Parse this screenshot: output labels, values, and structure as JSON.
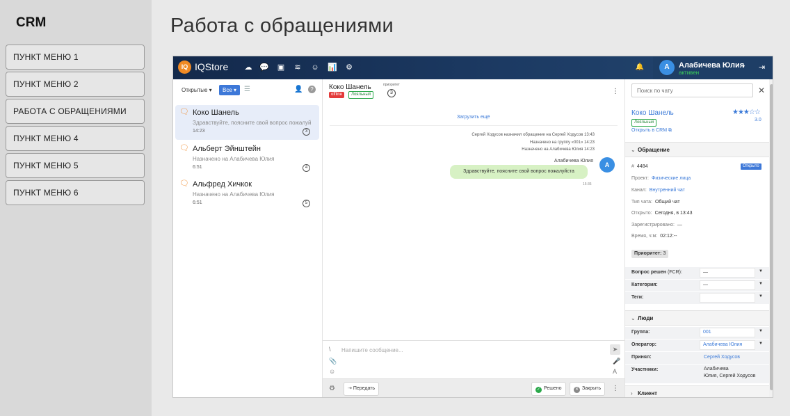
{
  "sidebar": {
    "title": "CRM",
    "items": [
      "ПУНКТ МЕНЮ 1",
      "ПУНКТ МЕНЮ 2",
      "РАБОТА С ОБРАЩЕНИЯМИ",
      "ПУНКТ МЕНЮ 4",
      "ПУНКТ МЕНЮ 5",
      "ПУНКТ МЕНЮ 6"
    ]
  },
  "page": {
    "title": "Работа с обращениями"
  },
  "app": {
    "logo": {
      "mark": "IQ",
      "name": "IQStore"
    },
    "topbar": {
      "icons": [
        "chats-icon",
        "messages-icon",
        "book-icon",
        "layers-icon",
        "users-icon",
        "stats-icon",
        "settings-icon"
      ],
      "user": {
        "avatar": "А",
        "name": "Алабичева Юлия",
        "status": "активен"
      }
    },
    "list": {
      "filter_open": "Открытые ▾",
      "filter_all": "Все ▾",
      "chats": [
        {
          "name": "Коко Шанель",
          "message": "Здравствуйте, поясните свой вопрос пожалуй",
          "time": "14:23",
          "count": "3"
        },
        {
          "name": "Альберт Эйнштейн",
          "message": "Назначено на Алабичева Юлия",
          "time": "6:51",
          "count": "4"
        },
        {
          "name": "Альфред Хичкок",
          "message": "Назначено на Алабичева Юлия",
          "time": "6:51",
          "count": "5"
        }
      ]
    },
    "chat": {
      "name": "Коко Шанель",
      "offline": "offline",
      "loyal": "Лояльный",
      "priority_label": "приоритет",
      "priority": "3",
      "load_more": "Загрузить ещё",
      "system": [
        "Сергей Ходусов назначил обращение на Сергей Ходусов 13:43",
        "Назначено на группу «001» 14:23",
        "Назначено на Алабичева Юлия 14:23"
      ],
      "message": {
        "author": "Алабичева Юлия",
        "avatar": "А",
        "text": "Здравствуйте, поясните свой вопрос пожалуйста",
        "time": "15:36"
      },
      "composer_placeholder": "Напишите сообщение...",
      "actions": {
        "transfer": "Передать",
        "resolved": "Решено",
        "close": "Закрыть"
      }
    },
    "details": {
      "search_placeholder": "Поиск по чату",
      "client_name": "Коко Шанель",
      "stars": "★★★☆☆",
      "rating": "3.0",
      "loyal": "Лояльный",
      "crm_link": "Открыть в CRM",
      "section_request": "Обращение",
      "number_label": "#",
      "number": "4484",
      "status_badge": "Открыто",
      "project_label": "Проект:",
      "project": "Физические лица",
      "channel_label": "Канал:",
      "channel": "Внутренний чат",
      "chat_type_label": "Тип чата:",
      "chat_type": "Общий чат",
      "opened_label": "Открыто:",
      "opened": "Сегодня, в 13:43",
      "registered_label": "Зарегистрировано:",
      "registered": "—",
      "time_label": "Время, ч:м:",
      "time": "02:12:--",
      "priority_label": "Приоритет:",
      "priority": "3",
      "resolved_label": "Вопрос решен",
      "resolved_label_thin": "(FCR):",
      "resolved_value": "—",
      "category_label": "Категория:",
      "category_value": "—",
      "tags_label": "Теги:",
      "tags_value": "",
      "section_people": "Люди",
      "group_label": "Группа:",
      "group_value": "001",
      "operator_label": "Оператор:",
      "operator_value": "Алабичева Юлия",
      "accepted_label": "Принял:",
      "accepted_value": "Сергей Ходусов",
      "participants_label": "Участники:",
      "participants_line1": "Алабичева",
      "participants_line2": "Юлия, Сергей Ходусов",
      "section_client": "Клиент"
    }
  }
}
